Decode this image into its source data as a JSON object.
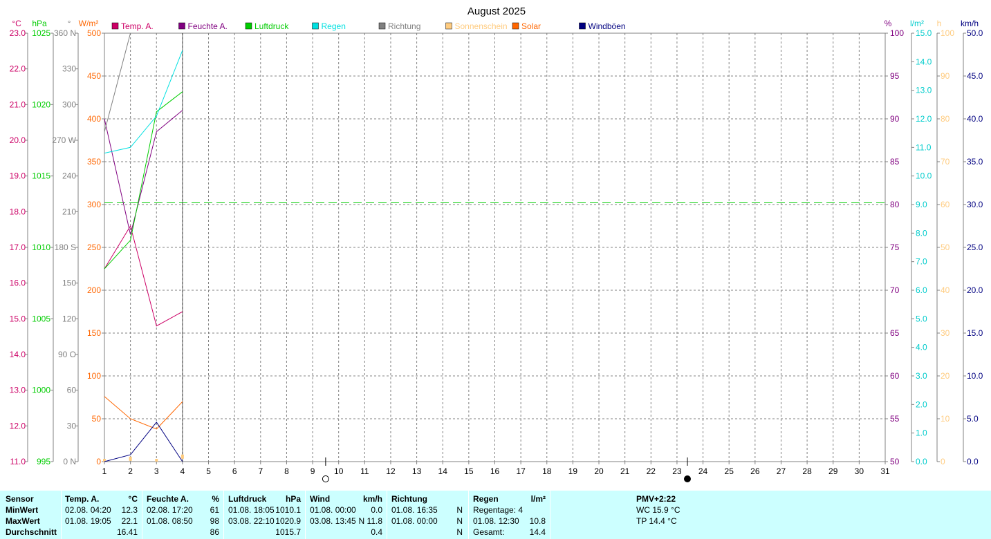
{
  "chart_data": {
    "type": "line",
    "title": "August 2025",
    "x": [
      1,
      2,
      3,
      4
    ],
    "x_ticks": [
      1,
      2,
      3,
      4,
      5,
      6,
      7,
      8,
      9,
      10,
      11,
      12,
      13,
      14,
      15,
      16,
      17,
      18,
      19,
      20,
      21,
      22,
      23,
      24,
      25,
      26,
      27,
      28,
      29,
      30,
      31
    ],
    "xlim": [
      1,
      31
    ],
    "grid": true,
    "legend_placement": "top",
    "axes": {
      "temp": {
        "unit": "°C",
        "color": "#cc0066",
        "min": 11,
        "max": 23,
        "ticks": [
          "11.0",
          "12.0",
          "13.0",
          "14.0",
          "15.0",
          "16.0",
          "17.0",
          "18.0",
          "19.0",
          "20.0",
          "21.0",
          "22.0",
          "23.0"
        ]
      },
      "press": {
        "unit": "hPa",
        "color": "#00cc00",
        "min": 995,
        "max": 1025,
        "ticks": [
          "995",
          "1000",
          "1005",
          "1010",
          "1015",
          "1020",
          "1025"
        ]
      },
      "dir": {
        "unit": "°",
        "color": "#808080",
        "min": 0,
        "max": 360,
        "ticks": [
          "0 N",
          "30",
          "60",
          "90 O",
          "120",
          "150",
          "180 S",
          "210",
          "240",
          "270 W",
          "300",
          "330",
          "360 N"
        ]
      },
      "solar": {
        "unit": "W/m²",
        "color": "#ff6600",
        "min": 0,
        "max": 500,
        "ticks": [
          "0",
          "50",
          "100",
          "150",
          "200",
          "250",
          "300",
          "350",
          "400",
          "450",
          "500"
        ]
      },
      "hum": {
        "unit": "%",
        "color": "#800080",
        "min": 50,
        "max": 100,
        "ticks": [
          "50",
          "55",
          "60",
          "65",
          "70",
          "75",
          "80",
          "85",
          "90",
          "95",
          "100"
        ]
      },
      "rain": {
        "unit": "l/m²",
        "color": "#00cccc",
        "min": 0,
        "max": 15,
        "ticks": [
          "0.0",
          "1.0",
          "2.0",
          "3.0",
          "4.0",
          "5.0",
          "6.0",
          "7.0",
          "8.0",
          "9.0",
          "10.0",
          "11.0",
          "12.0",
          "13.0",
          "14.0",
          "15.0"
        ]
      },
      "sun": {
        "unit": "h",
        "color": "#ffcc80",
        "min": 0,
        "max": 100,
        "ticks": [
          "0",
          "10",
          "20",
          "30",
          "40",
          "50",
          "60",
          "70",
          "80",
          "90",
          "100"
        ]
      },
      "wind": {
        "unit": "km/h",
        "color": "#000080",
        "min": 0,
        "max": 50,
        "ticks": [
          "0.0",
          "5.0",
          "10.0",
          "15.0",
          "20.0",
          "25.0",
          "30.0",
          "35.0",
          "40.0",
          "45.0",
          "50.0"
        ]
      }
    },
    "series": [
      {
        "name": "Temp. A.",
        "axis": "temp",
        "color": "#cc0066",
        "values": [
          16.4,
          17.6,
          14.8,
          15.2
        ]
      },
      {
        "name": "Feuchte A.",
        "axis": "hum",
        "color": "#800080",
        "values": [
          90,
          76.5,
          88.5,
          91
        ]
      },
      {
        "name": "Luftdruck",
        "axis": "press",
        "color": "#00cc00",
        "values": [
          1008.5,
          1010.5,
          1019.5,
          1020.9
        ]
      },
      {
        "name": "Regen",
        "axis": "rain",
        "color": "#00e0e0",
        "values": [
          10.8,
          11.0,
          12.1,
          14.4
        ]
      },
      {
        "name": "Richtung",
        "axis": "dir",
        "color": "#808080",
        "values": [
          277,
          360,
          null,
          null
        ]
      },
      {
        "name": "Sonnenschein",
        "axis": "sun",
        "color": "#ffcc80",
        "values": [
          0,
          0.5,
          0,
          1
        ]
      },
      {
        "name": "Solar",
        "axis": "solar",
        "color": "#ff6600",
        "values": [
          76,
          50,
          38,
          70
        ]
      },
      {
        "name": "Windböen",
        "axis": "wind",
        "color": "#000080",
        "values": [
          0,
          0.8,
          4.6,
          0
        ]
      }
    ],
    "reference_line": {
      "axis": "hum",
      "value": 80.2,
      "color": "#00cc00"
    },
    "moon_phases": [
      {
        "day": 9.5,
        "phase": "full"
      },
      {
        "day": 23.4,
        "phase": "new"
      }
    ]
  },
  "table": {
    "sensor": {
      "header": "Sensor",
      "min": "MinWert",
      "max": "MaxWert",
      "avg": "Durchschnitt"
    },
    "temp": {
      "header": "Temp. A.",
      "unit": "°C",
      "min_time": "02.08.  04:20",
      "min_val": "12.3",
      "max_time": "01.08.  19:05",
      "max_val": "22.1",
      "avg": "16.41"
    },
    "hum": {
      "header": "Feuchte A.",
      "unit": "%",
      "min_time": "02.08.  17:20",
      "min_val": "61",
      "max_time": "01.08.  08:50",
      "max_val": "98",
      "avg": "86"
    },
    "press": {
      "header": "Luftdruck",
      "unit": "hPa",
      "min_time": "01.08.  18:05",
      "min_val": "1010.1",
      "max_time": "03.08.  22:10",
      "max_val": "1020.9",
      "avg": "1015.7"
    },
    "wind": {
      "header": "Wind",
      "unit": "km/h",
      "min_time": "01.08.  00:00",
      "min_val": "0.0",
      "max_time": "03.08.  13:45",
      "max_val": "N 11.8",
      "avg": "0.4"
    },
    "dir": {
      "header": "Richtung",
      "min_time": "01.08.  16:35",
      "min_val": "N",
      "max_time": "01.08.  00:00",
      "max_val": "N",
      "avg": "N"
    },
    "rain": {
      "header": "Regen",
      "unit": "l/m²",
      "days": "Regentage: 4",
      "max_time": "01.08.  12:30",
      "max_val": "10.8",
      "total_label": "Gesamt:",
      "total_val": "14.4"
    },
    "pmv": {
      "header": "PMV+2:22",
      "wc": "WC 15.9 °C",
      "tp": "TP 14.4 °C"
    }
  }
}
